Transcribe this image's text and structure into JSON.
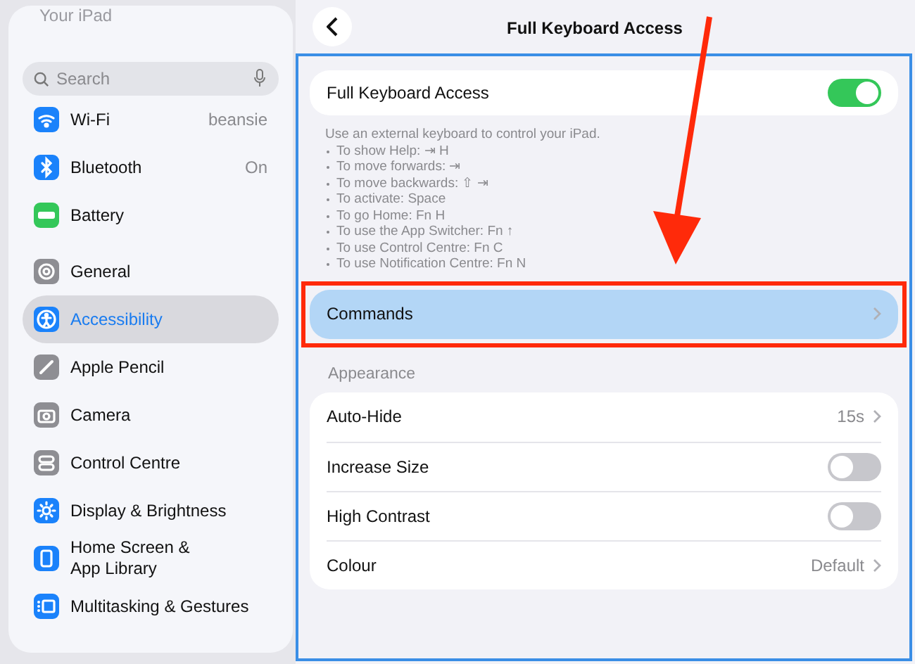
{
  "sidebar": {
    "header": "Your iPad",
    "search": {
      "placeholder": "Search"
    },
    "groups": [
      [
        {
          "label": "Wi-Fi",
          "value": "beansie",
          "color": "#1a82fb",
          "selected": false
        },
        {
          "label": "Bluetooth",
          "value": "On",
          "color": "#1a82fb",
          "selected": false
        },
        {
          "label": "Battery",
          "color": "#34c759",
          "selected": false
        }
      ],
      [
        {
          "label": "General",
          "color": "#8e8e93",
          "selected": false
        },
        {
          "label": "Accessibility",
          "color": "#1a82fb",
          "selected": true
        },
        {
          "label": "Apple Pencil",
          "color": "#8e8e93",
          "selected": false
        },
        {
          "label": "Camera",
          "color": "#8e8e93",
          "selected": false
        },
        {
          "label": "Control Centre",
          "color": "#8e8e93",
          "selected": false
        },
        {
          "label": "Display & Brightness",
          "color": "#1a82fb",
          "selected": false
        },
        {
          "label": "Home Screen & App Library",
          "color": "#1a82fb",
          "selected": false
        },
        {
          "label": "Multitasking & Gestures",
          "color": "#1a82fb",
          "selected": false
        }
      ]
    ]
  },
  "page": {
    "title": "Full Keyboard Access",
    "main_toggle": {
      "label": "Full Keyboard Access",
      "on": true
    },
    "description": "Use an external keyboard to control your iPad.",
    "shortcuts": [
      "To show Help: ⇥ H",
      "To move forwards: ⇥",
      "To move backwards: ⇧ ⇥",
      "To activate: Space",
      "To go Home: Fn H",
      "To use the App Switcher: Fn ↑",
      "To use Control Centre: Fn C",
      "To use Notification Centre: Fn N"
    ],
    "commands": {
      "label": "Commands",
      "highlighted": true
    },
    "appearance": {
      "heading": "Appearance",
      "rows": [
        {
          "kind": "link",
          "label": "Auto-Hide",
          "value": "15s"
        },
        {
          "kind": "toggle",
          "label": "Increase Size",
          "on": false
        },
        {
          "kind": "toggle",
          "label": "High Contrast",
          "on": false
        },
        {
          "kind": "link",
          "label": "Colour",
          "value": "Default"
        }
      ]
    }
  }
}
